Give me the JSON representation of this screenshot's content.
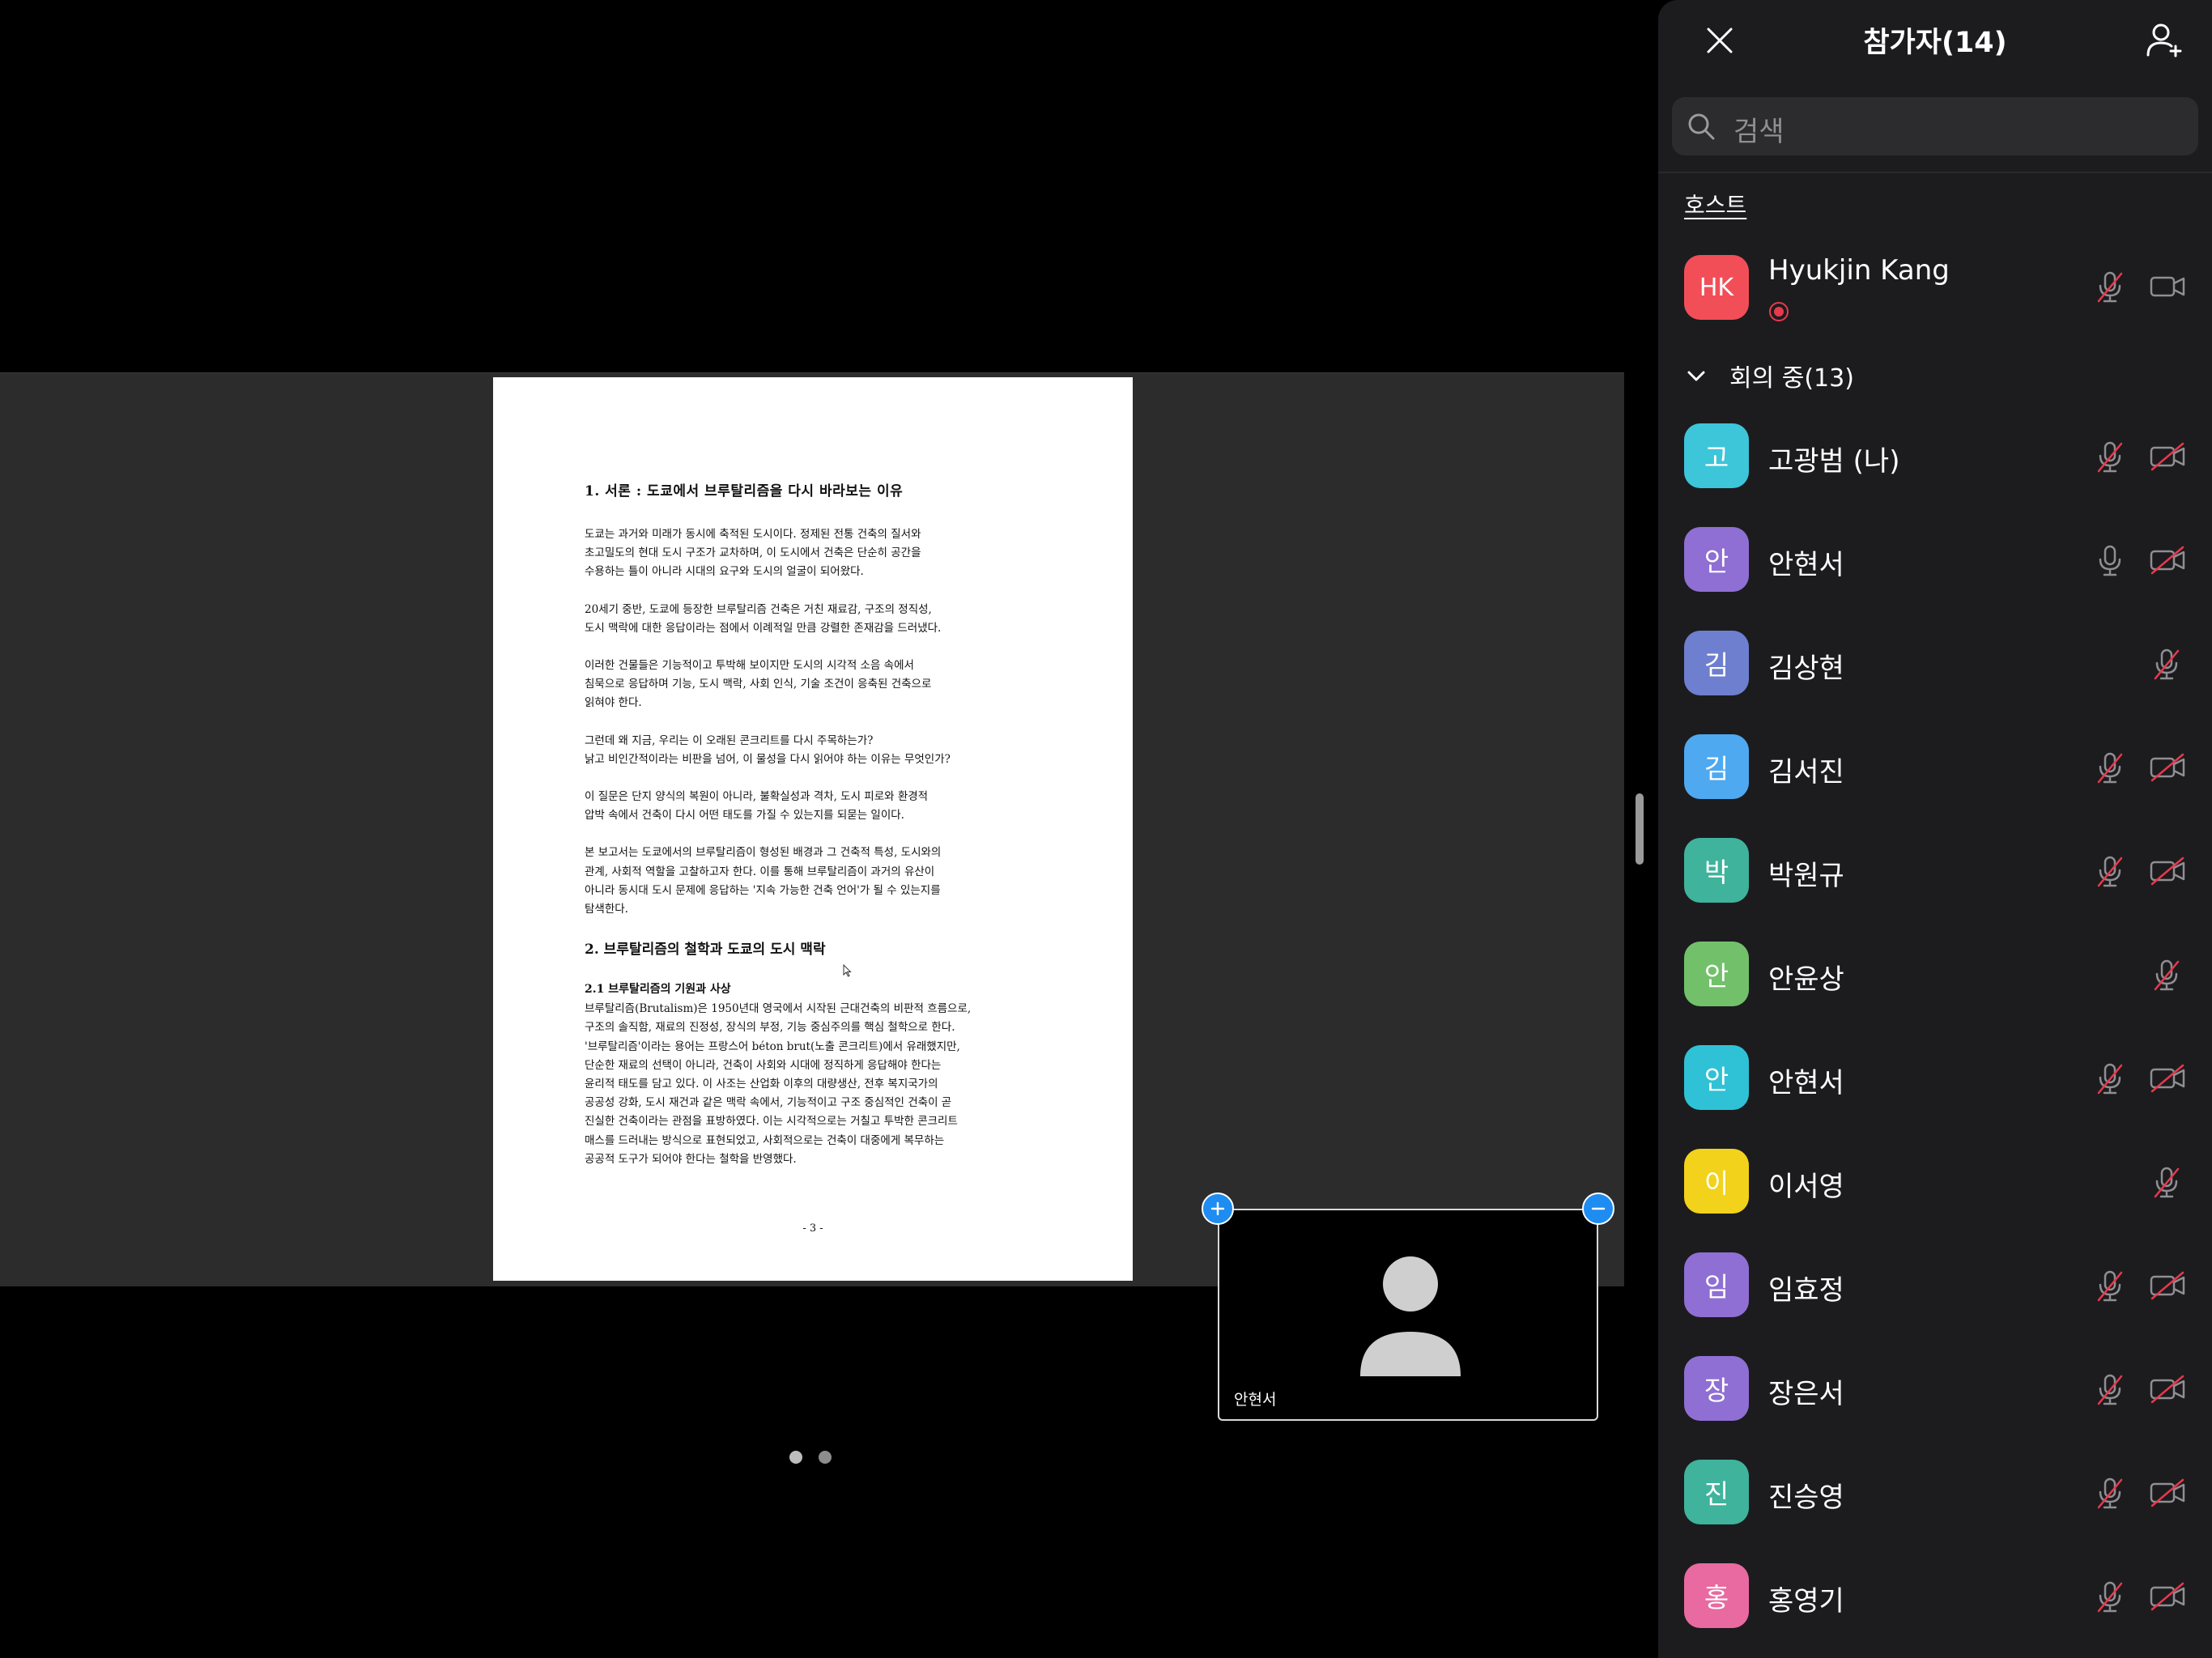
{
  "document": {
    "heading1": "1. 서론 : 도쿄에서 브루탈리즘을 다시 바라보는 이유",
    "paragraphs": [
      " 도쿄는 과거와 미래가 동시에 축적된 도시이다. 정제된 전통 건축의 질서와\n초고밀도의 현대 도시 구조가 교차하며, 이 도시에서 건축은 단순히 공간을\n수용하는 틀이 아니라 시대의 요구와 도시의 얼굴이 되어왔다.",
      "  20세기 중반, 도쿄에 등장한 브루탈리즘 건축은 거친 재료감, 구조의 정직성,\n도시 맥락에 대한 응답이라는 점에서 이례적일 만큼 강렬한 존재감을 드러냈다.",
      "  이러한 건물들은 기능적이고 투박해 보이지만 도시의 시각적 소음 속에서\n침묵으로 응답하며 기능, 도시 맥락, 사회 인식, 기술 조건이 응축된 건축으로\n읽혀야 한다.",
      "  그런데 왜 지금, 우리는 이 오래된 콘크리트를 다시 주목하는가?\n낡고 비인간적이라는 비판을 넘어, 이 물성을 다시 읽어야 하는 이유는 무엇인가?",
      "  이 질문은 단지 양식의 복원이 아니라, 불확실성과 격차, 도시 피로와 환경적\n압박 속에서 건축이 다시 어떤 태도를 가질 수 있는지를 되묻는 일이다.",
      "  본 보고서는 도쿄에서의 브루탈리즘이 형성된 배경과 그 건축적 특성, 도시와의\n관계, 사회적 역할을 고찰하고자 한다. 이를 통해 브루탈리즘이 과거의 유산이\n아니라 동시대 도시 문제에 응답하는 '지속 가능한 건축 언어'가 될 수 있는지를\n탐색한다."
    ],
    "heading2": "2. 브루탈리즘의 철학과 도쿄의 도시 맥락",
    "heading3": "2.1 브루탈리즘의 기원과 사상",
    "paragraph_last": "  브루탈리즘(Brutalism)은 1950년대 영국에서 시작된 근대건축의 비판적 흐름으로,\n구조의 솔직함, 재료의 진정성, 장식의 부정, 기능 중심주의를 핵심 철학으로 한다.\n'브루탈리즘'이라는 용어는 프랑스어 béton brut(노출 콘크리트)에서 유래했지만,\n단순한 재료의 선택이 아니라, 건축이 사회와 시대에 정직하게 응답해야 한다는\n윤리적 태도를 담고 있다. 이 사조는 산업화 이후의 대량생산, 전후 복지국가의\n공공성 강화, 도시 재건과 같은 맥락 속에서, 기능적이고 구조 중심적인 건축이 곧\n진실한 건축이라는 관점을 표방하였다. 이는 시각적으로는 거칠고 투박한 콘크리트\n매스를 드러내는 방식으로 표현되었고, 사회적으로는 건축이 대중에게 복무하는\n공공적 도구가 되어야 한다는 철학을 반영했다.",
    "page_number": "- 3 -"
  },
  "self_view": {
    "name": "안현서",
    "add_icon": "plus-icon",
    "remove_icon": "minus-icon"
  },
  "page_indicator": {
    "count": 2,
    "active": 0
  },
  "panel": {
    "title": "참가자(14)",
    "search_placeholder": "검색",
    "host_label": "호스트",
    "group_label": "회의 중(13)",
    "host": {
      "initials": "HK",
      "name": "Hyukjin Kang",
      "color": "#f24e57",
      "recording": true,
      "mic": "muted",
      "camera": "on"
    },
    "participants": [
      {
        "initial": "고",
        "name": "고광범 (나)",
        "color": "#3dc5d9",
        "mic": "muted",
        "camera": "off"
      },
      {
        "initial": "안",
        "name": "안현서",
        "color": "#8f6fd4",
        "mic": "on",
        "camera": "off"
      },
      {
        "initial": "김",
        "name": "김상현",
        "color": "#6e7fcf",
        "mic": "muted",
        "camera": "none"
      },
      {
        "initial": "김",
        "name": "김서진",
        "color": "#4ea9f0",
        "mic": "muted",
        "camera": "off"
      },
      {
        "initial": "박",
        "name": "박원규",
        "color": "#3fb39c",
        "mic": "muted",
        "camera": "off"
      },
      {
        "initial": "안",
        "name": "안윤상",
        "color": "#72c16a",
        "mic": "muted",
        "camera": "none"
      },
      {
        "initial": "안",
        "name": "안현서",
        "color": "#2fc2d6",
        "mic": "muted",
        "camera": "off"
      },
      {
        "initial": "이",
        "name": "이서영",
        "color": "#f2d21b",
        "mic": "muted",
        "camera": "none"
      },
      {
        "initial": "임",
        "name": "임효정",
        "color": "#8f6fd4",
        "mic": "muted",
        "camera": "off"
      },
      {
        "initial": "장",
        "name": "장은서",
        "color": "#8f6fd4",
        "mic": "muted",
        "camera": "off"
      },
      {
        "initial": "진",
        "name": "진승영",
        "color": "#3fb39c",
        "mic": "muted",
        "camera": "off"
      },
      {
        "initial": "홍",
        "name": "홍영기",
        "color": "#e86aa0",
        "mic": "muted",
        "camera": "off"
      }
    ]
  }
}
